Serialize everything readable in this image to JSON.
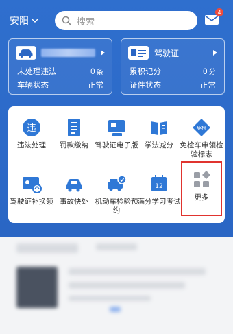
{
  "topbar": {
    "city": "安阳",
    "search_placeholder": "搜索",
    "mail_badge": "4"
  },
  "vehicle_card": {
    "plate_hidden": true,
    "row1_label": "未处理违法",
    "row1_value": "0",
    "row1_unit": "条",
    "row2_label": "车辆状态",
    "row2_value": "正常"
  },
  "license_card": {
    "title": "驾驶证",
    "row1_label": "累积记分",
    "row1_value": "0",
    "row1_unit": "分",
    "row2_label": "证件状态",
    "row2_value": "正常"
  },
  "services": [
    {
      "label": "违法处理",
      "icon": "violation-icon"
    },
    {
      "label": "罚款缴纳",
      "icon": "fine-payment-icon"
    },
    {
      "label": "驾驶证电子版",
      "icon": "e-license-icon"
    },
    {
      "label": "学法减分",
      "icon": "study-book-icon"
    },
    {
      "label": "免检车申领检验标志",
      "icon": "exempt-inspection-icon"
    },
    {
      "label": "驾驶证补换领",
      "icon": "license-reissue-icon"
    },
    {
      "label": "事故快处",
      "icon": "accident-car-icon"
    },
    {
      "label": "机动车检验预约",
      "icon": "inspection-appointment-icon"
    },
    {
      "label": "满分学习考试",
      "icon": "calendar-exam-icon"
    },
    {
      "label": "更多",
      "icon": "more-grid-icon"
    }
  ],
  "icon_texts": {
    "violation": "违",
    "calendar": "12",
    "exempt": "免检"
  },
  "colors": {
    "brand_blue": "#2a66c4",
    "icon_blue": "#2f78d6",
    "highlight_red": "#e0342f"
  }
}
